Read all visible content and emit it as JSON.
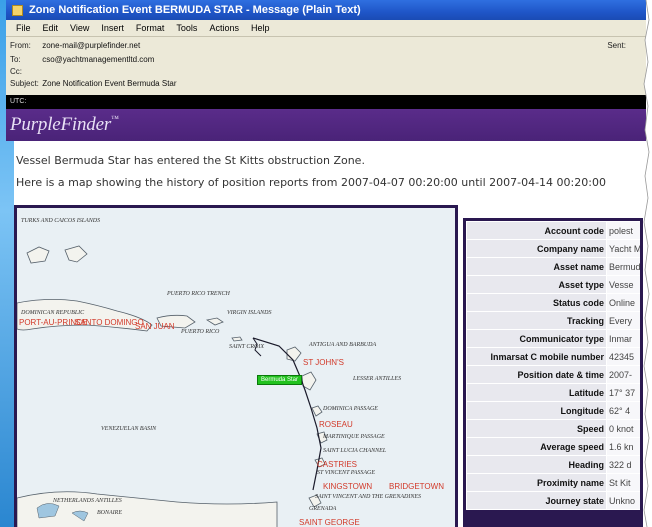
{
  "window": {
    "title": "Zone Notification Event BERMUDA STAR - Message (Plain Text)"
  },
  "menu": [
    "File",
    "Edit",
    "View",
    "Insert",
    "Format",
    "Tools",
    "Actions",
    "Help"
  ],
  "header": {
    "from_label": "From:",
    "from": "zone-mail@purplefinder.net",
    "to_label": "To:",
    "to": "cso@yachtmanagementltd.com",
    "cc_label": "Cc:",
    "cc": "",
    "subject_label": "Subject:",
    "subject": "Zone Notification Event Bermuda Star",
    "sent_label": "Sent:"
  },
  "utc_label": "UTC:",
  "brand": {
    "logo": "PurpleFinder",
    "trademark": "™"
  },
  "message": {
    "line1": "Vessel Bermuda Star has entered the St Kitts obstruction Zone.",
    "line2": "Here is a map showing the history of position reports from 2007-04-07 00:20:00 until 2007-04-14 00:20:00"
  },
  "map": {
    "vessel_label": "Bermuda Star",
    "labels": [
      "TURKS AND CAICOS ISLANDS",
      "PUERTO RICO TRENCH",
      "VIRGIN ISLANDS",
      "DOMINICAN REPUBLIC",
      "PUERTO RICO",
      "SAINT CROIX",
      "ANTIGUA AND BARBUDA",
      "LESSER ANTILLES",
      "DOMINICA PASSAGE",
      "VENEZUELAN BASIN",
      "MARTINIQUE PASSAGE",
      "SAINT LUCIA CHANNEL",
      "ST VINCENT PASSAGE",
      "SAINT VINCENT AND THE GRENADINES",
      "NETHERLANDS ANTILLES",
      "BONAIRE",
      "GRENADA"
    ],
    "places": [
      "PORT-AU-PRINCE",
      "SANTO DOMINGO",
      "SAN JUAN",
      "ST JOHN'S",
      "ROSEAU",
      "CASTRIES",
      "KINGSTOWN",
      "BRIDGETOWN",
      "SAINT GEORGE"
    ]
  },
  "info_rows": [
    {
      "key": "Account code",
      "value": "polest"
    },
    {
      "key": "Company name",
      "value": "Yacht M"
    },
    {
      "key": "Asset name",
      "value": "Bermud"
    },
    {
      "key": "Asset type",
      "value": "Vesse"
    },
    {
      "key": "Status code",
      "value": "Online"
    },
    {
      "key": "Tracking",
      "value": "Every"
    },
    {
      "key": "Communicator type",
      "value": "Inmar"
    },
    {
      "key": "Inmarsat C mobile number",
      "value": "42345"
    },
    {
      "key": "Position date & time",
      "value": "2007-"
    },
    {
      "key": "Latitude",
      "value": "17° 37"
    },
    {
      "key": "Longitude",
      "value": "62° 4"
    },
    {
      "key": "Speed",
      "value": "0 knot"
    },
    {
      "key": "Average speed",
      "value": "1.6 kn"
    },
    {
      "key": "Heading",
      "value": "322 d"
    },
    {
      "key": "Proximity name",
      "value": "St Kit"
    },
    {
      "key": "Journey state",
      "value": "Unkno"
    }
  ],
  "colors": {
    "banner": "#4a2378",
    "titlebar": "#1f56c8",
    "vessel": "#22c21e",
    "place": "#d23a2a"
  }
}
